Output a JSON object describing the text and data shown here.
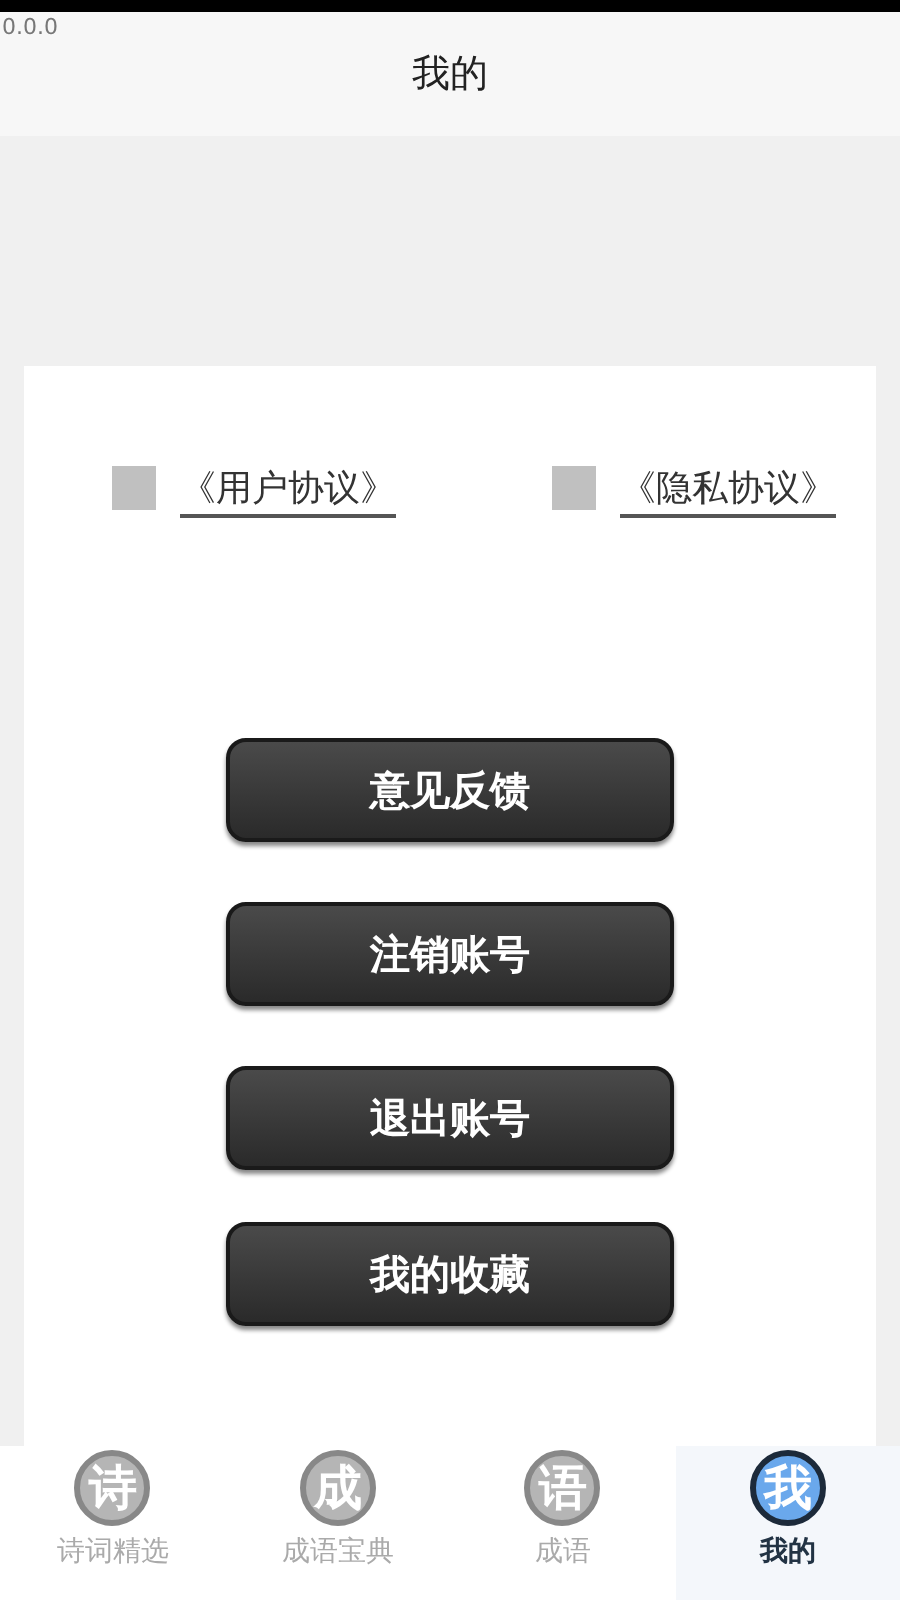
{
  "version": "0.0.0",
  "title": "我的",
  "agreements": [
    {
      "label": "《用户协议》",
      "checked": false
    },
    {
      "label": "《隐私协议》",
      "checked": false
    }
  ],
  "buttons": [
    "意见反馈",
    "注销账号",
    "退出账号",
    "我的收藏"
  ],
  "tabs": [
    {
      "icon_char": "诗",
      "label": "诗词精选",
      "selected": false
    },
    {
      "icon_char": "成",
      "label": "成语宝典",
      "selected": false
    },
    {
      "icon_char": "语",
      "label": "成语",
      "selected": false
    },
    {
      "icon_char": "我",
      "label": "我的",
      "selected": true
    }
  ]
}
